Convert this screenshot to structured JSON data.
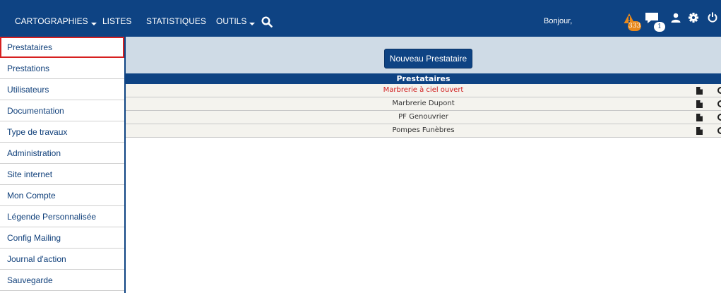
{
  "nav": {
    "cartographies": "CARTOGRAPHIES",
    "listes": "LISTES",
    "statistiques": "STATISTIQUES",
    "outils": "OUTILS",
    "greeting": "Bonjour,",
    "alerts_count": "333",
    "messages_count": "1",
    "icons": [
      "search-icon",
      "warning-icon",
      "message-icon",
      "user-icon",
      "gear-icon",
      "power-icon"
    ]
  },
  "sidebar": {
    "items": [
      {
        "label": "Prestataires",
        "active": true
      },
      {
        "label": "Prestations"
      },
      {
        "label": "Utilisateurs"
      },
      {
        "label": "Documentation"
      },
      {
        "label": "Type de travaux"
      },
      {
        "label": "Administration"
      },
      {
        "label": "Site internet"
      },
      {
        "label": "Mon Compte"
      },
      {
        "label": "Légende Personnalisée"
      },
      {
        "label": "Config Mailing"
      },
      {
        "label": "Journal d'action"
      },
      {
        "label": "Sauvegarde"
      }
    ]
  },
  "main": {
    "new_button": "Nouveau Prestataire",
    "table_title": "Prestataires",
    "rows": [
      {
        "name": "Marbrerie à ciel ouvert",
        "highlighted": true
      },
      {
        "name": "Marbrerie Dupont"
      },
      {
        "name": "PF Genouvrier"
      },
      {
        "name": "Pompes Funèbres"
      }
    ]
  },
  "colors": {
    "nav_bg": "#0e4383",
    "button_zone_bg": "#cfdbe6",
    "highlight_text": "#d01b1b",
    "alert_badge": "#e8891c",
    "active_border": "#d62020"
  }
}
